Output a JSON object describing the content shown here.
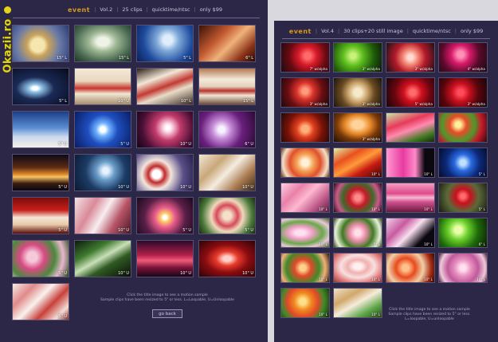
{
  "watermark": "Okazii.ro",
  "left": {
    "brand": "event",
    "volume": "Vol.2",
    "clips": "25 clips",
    "format": "quicktime/ntsc",
    "price": "only $99",
    "tiles": [
      {
        "label": "15\" L",
        "bg": "radial-gradient(circle at 45% 55%, #f5e6b0 0 18%, #c9a35a 30%, #6a7aa8 60%, #2a3b73 100%)"
      },
      {
        "label": "15\" L",
        "bg": "radial-gradient(ellipse at 50% 45%, #eef3e6 0 15%, #9fb894 35%, #4a6a52 70%, #1f3323 100%)"
      },
      {
        "label": "5\" L",
        "bg": "radial-gradient(circle at 55% 40%, #dfeefa 0 12%, #7fa8d8 30%, #1d4a9c 65%, #0d1f55 100%)"
      },
      {
        "label": "6\" L",
        "bg": "linear-gradient(135deg, #3a1208 0%, #c25a30 35%, #f0b27a 55%, #8a3318 80%, #2a0c05 100%)"
      },
      {
        "label": "5\" L",
        "bg": "radial-gradient(ellipse at 40% 55%, #ffffff 0 6%, #8fc4e8 14%, #1a2a55 40%, #070a1c 100%)"
      },
      {
        "label": "10\" U",
        "bg": "linear-gradient(180deg, #f4ead8 0%, #e9d7bd 35%, #c8352f 55%, #f1e6d3 70%, #a78d6c 100%)"
      },
      {
        "label": "10\" L",
        "bg": "linear-gradient(160deg, #2a1d16 0%, #f2e7d6 30%, #c23a33 50%, #e8dcc8 65%, #3a2a20 100%)"
      },
      {
        "label": "15\" L",
        "bg": "linear-gradient(180deg, #b27a55 0%, #f4e9d8 30%, #e2d2bc 50%, #b8322c 62%, #f1e6d4 75%, #6d4b36 100%)"
      },
      {
        "label": "5\" U",
        "bg": "linear-gradient(180deg, #1b3f86 0%, #5b8cd2 45%, #c9d9ef 70%, #f5f0e6 100%)"
      },
      {
        "label": "5\" U",
        "bg": "radial-gradient(circle at 50% 50%, #ffffff 0 8%, #6fb2ff 20%, #1f4fbf 45%, #0a1d63 100%)"
      },
      {
        "label": "10\" U",
        "bg": "radial-gradient(circle at 55% 45%, #ffffff 0 5%, #ffd7e6 12%, #c23a6a 35%, #4a0f36 70%, #120514 100%)"
      },
      {
        "label": "6\" U",
        "bg": "radial-gradient(circle at 40% 50%, #f7f2ff 0 8%, #c58ad6 25%, #6a1f7d 55%, #2a0a33 100%)"
      },
      {
        "label": "5\" U",
        "bg": "linear-gradient(180deg, #0c0a18 0%, #5a2a14 35%, #e08a2a 55%, #f7c464 62%, #3a1d10 80%, #080610 100%)"
      },
      {
        "label": "10\" U",
        "bg": "radial-gradient(circle at 55% 45%, #e6f2ff 0 8%, #6b9dc9 25%, #1c3c66 55%, #0b1830 100%)"
      },
      {
        "label": "10\" U",
        "bg": "radial-gradient(circle at 35% 55%, #ffffff 0 10%, #c22a2a 20%, #f2e6dc 35%, #5a4f88 65%, #262048 100%)"
      },
      {
        "label": "10\" U",
        "bg": "linear-gradient(135deg, #f3e7d4 0%, #c9a77a 30%, #f5ecdf 50%, #a8794e 75%, #3b2a1c 100%)"
      },
      {
        "label": "5\" U",
        "bg": "linear-gradient(180deg, #7a0d0a 0%, #c8201b 35%, #f3e6d8 55%, #e8c8a8 75%, #5a0a08 100%)"
      },
      {
        "label": "10\" U",
        "bg": "linear-gradient(120deg, #f1e3e6 0%, #d98a99 30%, #f7eef0 50%, #b75467 72%, #4a1828 100%)"
      },
      {
        "label": "5\" U",
        "bg": "radial-gradient(circle at 50% 55%, #ffffff 0 6%, #ffd36b 12%, #e85a8a 30%, #5a1f48 60%, #1a0a1c 100%)"
      },
      {
        "label": "5\" U",
        "bg": "radial-gradient(circle at 50% 50%, #f4e0c8 0 12%, #d64a5a 32%, #f0d8bc 48%, #4a7a3a 75%, #1c2a14 100%)"
      },
      {
        "label": "5\" U",
        "bg": "radial-gradient(circle at 35% 45%, #f5c9d8 0 12%, #d94a84 30%, #4a8a3c 55%, #e7b7cc 75%, #2a4a1c 100%)"
      },
      {
        "label": "10\" U",
        "bg": "linear-gradient(150deg, #0c1a0c 0%, #3f7a2f 30%, #c9e0b8 48%, #2f5a22 65%, #0a0f08 100%)"
      },
      {
        "label": "10\" U",
        "bg": "linear-gradient(180deg, #2a0a2a 0%, #b2204a 40%, #f05a7a 55%, #7a1238 75%, #1a0616 100%)"
      },
      {
        "label": "10\" U",
        "bg": "radial-gradient(ellipse at 50% 50%, #ffd0c8 0 10%, #e83a2a 28%, #8a0c10 55%, #2a0408 100%)"
      },
      {
        "label": "5\" U",
        "bg": "linear-gradient(135deg, #f6ece8 0%, #e08a8a 25%, #f9f2ee 45%, #c8403a 65%, #f3dcd6 85%, #8a2a26 100%)"
      }
    ],
    "footnote_line1": "Click the title image to see a motion sample",
    "footnote_line2": "Sample clips have been resized to 5\" or less. L=Loopable, U=Unloopable",
    "back_label": "go back"
  },
  "right": {
    "brand": "event",
    "volume": "Vol.4",
    "clips": "30 clips+20 still image",
    "format": "quicktime/ntsc",
    "price": "only $99",
    "tiles": [
      {
        "label": "7\" w/alpha",
        "bg": "radial-gradient(circle at 55% 45%, #ff6b6b 0 10%, #d91a2a 30%, #6a0a12 60%, #1a0a10 100%)"
      },
      {
        "label": "3\" w/alpha",
        "bg": "radial-gradient(circle at 40% 45%, #c9f27a 0 8%, #5fbf1e 30%, #1f5a0a 65%, #0a1a05 100%)"
      },
      {
        "label": "3\" w/alpha",
        "bg": "radial-gradient(circle at 50% 50%, #ffd9cf 0 10%, #f07a6a 30%, #b21a2a 55%, #1f1014 100%)"
      },
      {
        "label": "4\" w/alpha",
        "bg": "radial-gradient(circle at 45% 40%, #ff8fb5 0 10%, #d81a6a 30%, #5a0a2a 60%, #1a0a12 100%)"
      },
      {
        "label": "3\" w/alpha",
        "bg": "radial-gradient(circle at 50% 45%, #ff9a7a 0 10%, #d8322a 30%, #6a0e12 60%, #18090c 100%)"
      },
      {
        "label": "3\" w/alpha",
        "bg": "radial-gradient(circle at 50% 50%, #f5e9c8 0 14%, #c9a36a 35%, #6a4a22 60%, #1a140a 100%)"
      },
      {
        "label": "5\" w/alpha",
        "bg": "radial-gradient(circle at 55% 50%, #ff6a6a 0 10%, #d0101e 30%, #6a0510 60%, #18070a 100%)"
      },
      {
        "label": "3\" w/alpha",
        "bg": "radial-gradient(circle at 45% 50%, #ff4a5a 0 10%, #c8101e 30%, #5a050c 60%, #14060a 100%)"
      },
      {
        "label": "",
        "bg": "radial-gradient(circle at 50% 55%, #ffb07a 0 12%, #e0401e 30%, #7a1208 60%, #1a0a08 100%)"
      },
      {
        "label": "3\" w/alpha",
        "bg": "radial-gradient(ellipse at 50% 40%, #ffd29a 0 16%, #e88a2a 38%, #7a3a08 62%, #1a0f06 100%)"
      },
      {
        "label": "",
        "bg": "linear-gradient(160deg, #c8e6a8 0%, #e83a5a 35%, #ff8ab0 55%, #3f7a22 80%, #122a0a 100%)"
      },
      {
        "label": "",
        "bg": "radial-gradient(circle at 40% 40%, #fff09a 0 8%, #e84a2a 25%, #4a9a2a 50%, #c81a2a 70%, #2a0a0a 100%)"
      },
      {
        "label": "",
        "bg": "radial-gradient(circle at 50% 50%, #fff1d8 0 12%, #f5a55a 30%, #e0502a 55%, #f2e0c8 80%, #6a3010 100%)"
      },
      {
        "label": "10\" L",
        "bg": "linear-gradient(150deg, #e0f0a8 0%, #e8501e 30%, #ff9a3a 50%, #c81a12 70%, #3a0a06 100%)"
      },
      {
        "label": "10\" L",
        "bg": "linear-gradient(90deg, #ff9ad0 0%, #e83aa0 35%, #ff8ac8 60%, #0c0810 80%, #0c0810 100%)"
      },
      {
        "label": "5\" L",
        "bg": "radial-gradient(circle at 50% 50%, #bfe0ff 0 10%, #2a6ae0 30%, #0c2a7a 60%, #060c2a 100%)"
      },
      {
        "label": "10\" L",
        "bg": "linear-gradient(135deg, #ffd0e0 0%, #e880a8 30%, #ffb8d0 50%, #c05a8a 75%, #5a2040 100%)"
      },
      {
        "label": "10\" L",
        "bg": "radial-gradient(circle at 50% 50%, #ff8a8a 0 10%, #c81a2a 30%, #3f6a2a 55%, #c85a8a 75%, #2a0a14 100%)"
      },
      {
        "label": "10\" L",
        "bg": "linear-gradient(180deg, #f0a0c0 0%, #e04a8a 35%, #f6b8d0 50%, #d05090 65%, #6a1a3a 100%)"
      },
      {
        "label": "5\" L",
        "bg": "radial-gradient(circle at 50% 45%, #ff6a6a 0 8%, #c8101e 25%, #5a6a3a 55%, #1a1a10 100%)"
      },
      {
        "label": "10\" L",
        "bg": "radial-gradient(ellipse at 40% 50%, #ffe0f0 0 12%, #f0a0c8 30%, #6aa84a 55%, #e8c8d8 75%, #4a6a2a 100%)"
      },
      {
        "label": "5\" L",
        "bg": "radial-gradient(circle at 50% 50%, #ffe0e8 0 10%, #f090b0 28%, #3f7a22 55%, #e8f0d8 80%, #2a4a14 100%)"
      },
      {
        "label": "10\" L",
        "bg": "linear-gradient(135deg, #f0d0e8 0%, #c85aa0 30%, #f8e0ef 50%, #0c0810 75%, #0c0810 100%)"
      },
      {
        "label": "6\" L",
        "bg": "radial-gradient(circle at 40% 40%, #e8ffa8 0 10%, #6ad02a 30%, #1f6a0a 60%, #0a1a05 100%)"
      },
      {
        "label": "10\" L",
        "bg": "radial-gradient(circle at 45% 50%, #ffd08a 0 10%, #e04a2a 28%, #3f8a2a 55%, #f0b07a 75%, #2a1a0a 100%)"
      },
      {
        "label": "10\" L",
        "bg": "radial-gradient(ellipse at 50% 45%, #fff0f0 0 12%, #f0b0b0 30%, #f8e0e0 50%, #e07a7a 75%, #8a3a3a 100%)"
      },
      {
        "label": "10\" L",
        "bg": "radial-gradient(circle at 40% 50%, #ffc08a 0 10%, #e84a1e 30%, #f0d0a8 55%, #a82a12 80%, #2a0c06 100%)"
      },
      {
        "label": "10\" L",
        "bg": "radial-gradient(circle at 50% 50%, #ffe0f0 0 10%, #e890c0 30%, #c05a9a 55%, #f0c8dc 80%, #4a1a34 100%)"
      },
      {
        "label": "10\" L",
        "bg": "radial-gradient(circle at 45% 45%, #ffe08a 0 10%, #f08a1e 28%, #e04a2a 50%, #3f8a2a 70%, #1a2a0a 100%)"
      },
      {
        "label": "10\" L",
        "bg": "linear-gradient(150deg, #f0e0c8 0%, #d0a86a 30%, #f6ecdc 50%, #5fa84a 75%, #2a4a1a 100%)"
      }
    ],
    "footnote_line1": "Click the title image to see a motion sample",
    "footnote_line2": "Sample clips have been resized to 5\" or less.",
    "footnote_line3": "L=loopable, U=unloopable"
  }
}
